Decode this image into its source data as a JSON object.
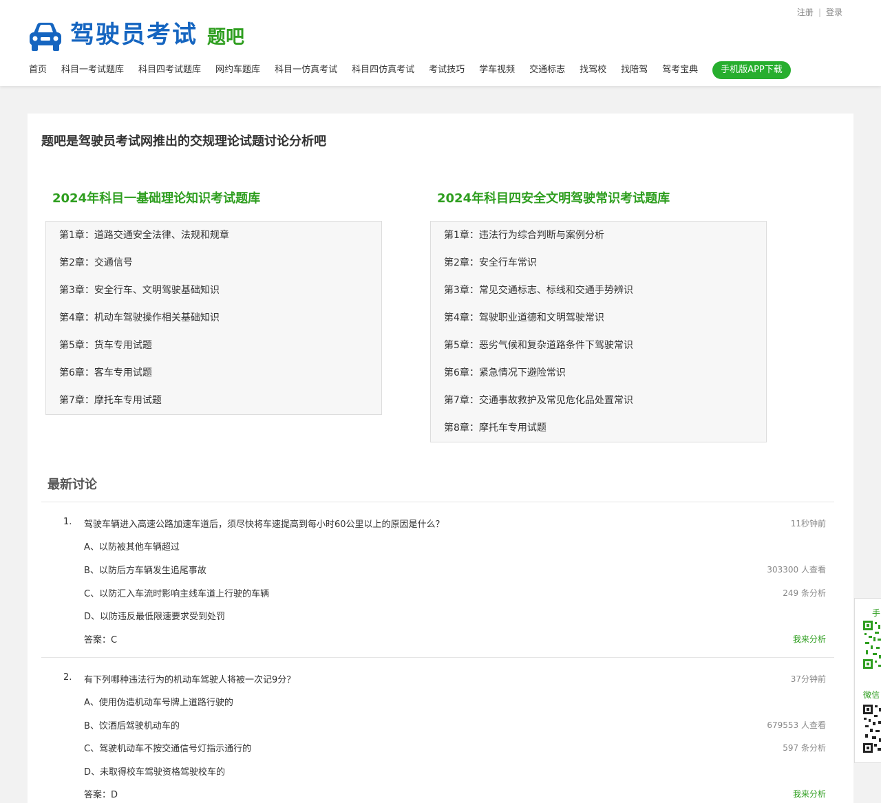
{
  "header": {
    "register": "注册",
    "login": "登录",
    "logo_title": "驾驶员考试",
    "logo_sub": "题吧",
    "nav": [
      "首页",
      "科目一考试题库",
      "科目四考试题库",
      "网约车题库",
      "科目一仿真考试",
      "科目四仿真考试",
      "考试技巧",
      "学车视频",
      "交通标志",
      "找驾校",
      "找陪驾",
      "驾考宝典"
    ],
    "app_button": "手机版APP下载"
  },
  "intro": "题吧是驾驶员考试网推出的交规理论试题讨论分析吧",
  "subject1": {
    "title": "2024年科目一基础理论知识考试题库",
    "chapters": [
      "第1章：道路交通安全法律、法规和规章",
      "第2章：交通信号",
      "第3章：安全行车、文明驾驶基础知识",
      "第4章：机动车驾驶操作相关基础知识",
      "第5章：货车专用试题",
      "第6章：客车专用试题",
      "第7章：摩托车专用试题"
    ]
  },
  "subject4": {
    "title": "2024年科目四安全文明驾驶常识考试题库",
    "chapters": [
      "第1章：违法行为综合判断与案例分析",
      "第2章：安全行车常识",
      "第3章：常见交通标志、标线和交通手势辨识",
      "第4章：驾驶职业道德和文明驾驶常识",
      "第5章：恶劣气候和复杂道路条件下驾驶常识",
      "第6章：紧急情况下避险常识",
      "第7章：交通事故救护及常见危化品处置常识",
      "第8章：摩托车专用试题"
    ]
  },
  "latest": {
    "title": "最新讨论",
    "questions": [
      {
        "num": "1.",
        "text": "驾驶车辆进入高速公路加速车道后，须尽快将车速提高到每小时60公里以上的原因是什么？",
        "time": "11秒钟前",
        "options": [
          "A、以防被其他车辆超过",
          "B、以防后方车辆发生追尾事故",
          "C、以防汇入车流时影响主线车道上行驶的车辆",
          "D、以防违反最低限速要求受到处罚"
        ],
        "answer": "答案：C",
        "views": "303300 人查看",
        "analyses": "249 条分析",
        "analyze_link": "我来分析"
      },
      {
        "num": "2.",
        "text": "有下列哪种违法行为的机动车驾驶人将被一次记9分？",
        "time": "37分钟前",
        "options": [
          "A、使用伪造机动车号牌上道路行驶的",
          "B、饮酒后驾驶机动车的",
          "C、驾驶机动车不按交通信号灯指示通行的",
          "D、未取得校车驾驶资格驾驶校车的"
        ],
        "answer": "答案：D",
        "views": "679553 人查看",
        "analyses": "597 条分析",
        "analyze_link": "我来分析"
      }
    ]
  },
  "float": {
    "label1": "手",
    "label2": "微信"
  },
  "colors": {
    "brand_blue": "#1565c0",
    "brand_green": "#2e9e1f",
    "app_button": "#27ae2e"
  }
}
